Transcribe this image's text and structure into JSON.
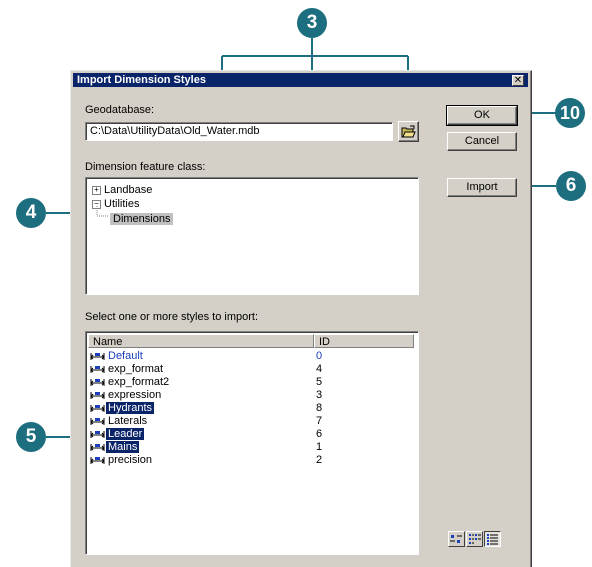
{
  "dialog": {
    "title": "Import Dimension Styles",
    "close_glyph": "✕"
  },
  "geodatabase": {
    "label": "Geodatabase:",
    "path": "C:\\Data\\UtilityData\\Old_Water.mdb",
    "browse_icon": "open-folder-icon"
  },
  "buttons": {
    "ok": "OK",
    "cancel": "Cancel",
    "import": "Import"
  },
  "feature_class": {
    "label": "Dimension feature class:",
    "tree": [
      {
        "label": "Landbase",
        "expander": "+"
      },
      {
        "label": "Utilities",
        "expander": "−"
      },
      {
        "label": "Dimensions",
        "selected": true
      }
    ]
  },
  "styles": {
    "label": "Select one or more styles to import:",
    "columns": [
      "Name",
      "ID"
    ],
    "rows": [
      {
        "name": "Default",
        "id": "0"
      },
      {
        "name": "exp_format",
        "id": "4"
      },
      {
        "name": "exp_format2",
        "id": "5"
      },
      {
        "name": "expression",
        "id": "3"
      },
      {
        "name": "Hydrants",
        "id": "8"
      },
      {
        "name": "Laterals",
        "id": "7"
      },
      {
        "name": "Leader",
        "id": "6"
      },
      {
        "name": "Mains",
        "id": "1"
      },
      {
        "name": "precision",
        "id": "2"
      }
    ]
  },
  "view_buttons": [
    "large-icons-view-icon",
    "list-view-icon",
    "details-view-icon"
  ],
  "callouts": {
    "c3": "3",
    "c4": "4",
    "c5": "5",
    "c6": "6",
    "c10": "10"
  },
  "colors": {
    "callout": "#1d6f80",
    "selection": "#0a246a",
    "titlebar": "#0a246a",
    "default_text": "#1a3fbf"
  }
}
